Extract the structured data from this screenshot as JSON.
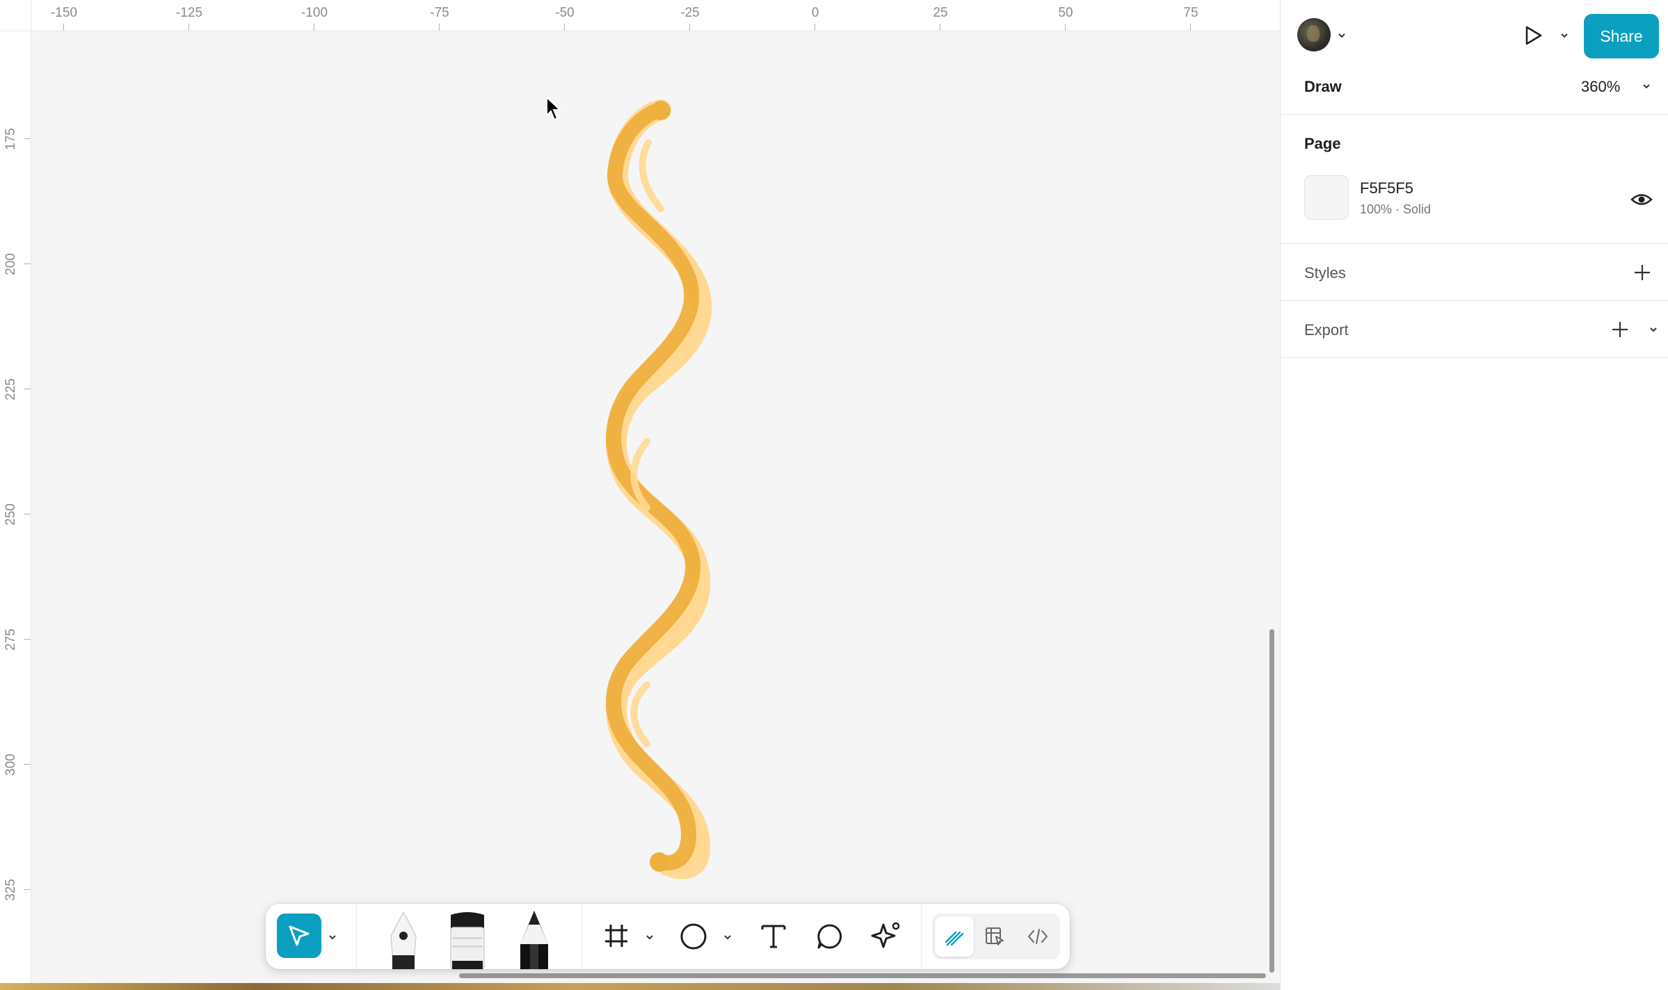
{
  "canvas": {
    "background": "#F5F5F5",
    "ruler_top_labels": [
      "-150",
      "-125",
      "-100",
      "-75",
      "-50",
      "-25",
      "0",
      "25",
      "50",
      "75"
    ],
    "ruler_left_labels": [
      "175",
      "200",
      "225",
      "250",
      "275",
      "300",
      "325"
    ],
    "stroke_colors": {
      "dark": "#EEAF3C",
      "light": "#FFD993"
    }
  },
  "toolbar": {
    "tools": [
      {
        "name": "select",
        "icon": "pointer-arrow-icon",
        "active": true
      },
      {
        "name": "pen",
        "icon": "pen-icon"
      },
      {
        "name": "marker",
        "icon": "marker-icon"
      },
      {
        "name": "pencil",
        "icon": "pencil-icon"
      },
      {
        "name": "frame",
        "icon": "frame-hash-icon"
      },
      {
        "name": "ellipse",
        "icon": "ellipse-icon"
      },
      {
        "name": "text",
        "icon": "text-icon",
        "glyph": "T"
      },
      {
        "name": "comment",
        "icon": "speech-bubble-icon"
      },
      {
        "name": "actions",
        "icon": "sparkle-icon"
      }
    ],
    "modes": [
      {
        "name": "draw",
        "icon": "draw-mode-icon",
        "active": true
      },
      {
        "name": "design",
        "icon": "design-mode-icon"
      },
      {
        "name": "dev",
        "icon": "code-icon"
      }
    ]
  },
  "panel": {
    "share_label": "Share",
    "mode_label": "Draw",
    "zoom": "360%",
    "page": {
      "heading": "Page",
      "fill_hex": "F5F5F5",
      "fill_meta": "100% · Solid"
    },
    "styles_label": "Styles",
    "export_label": "Export"
  }
}
